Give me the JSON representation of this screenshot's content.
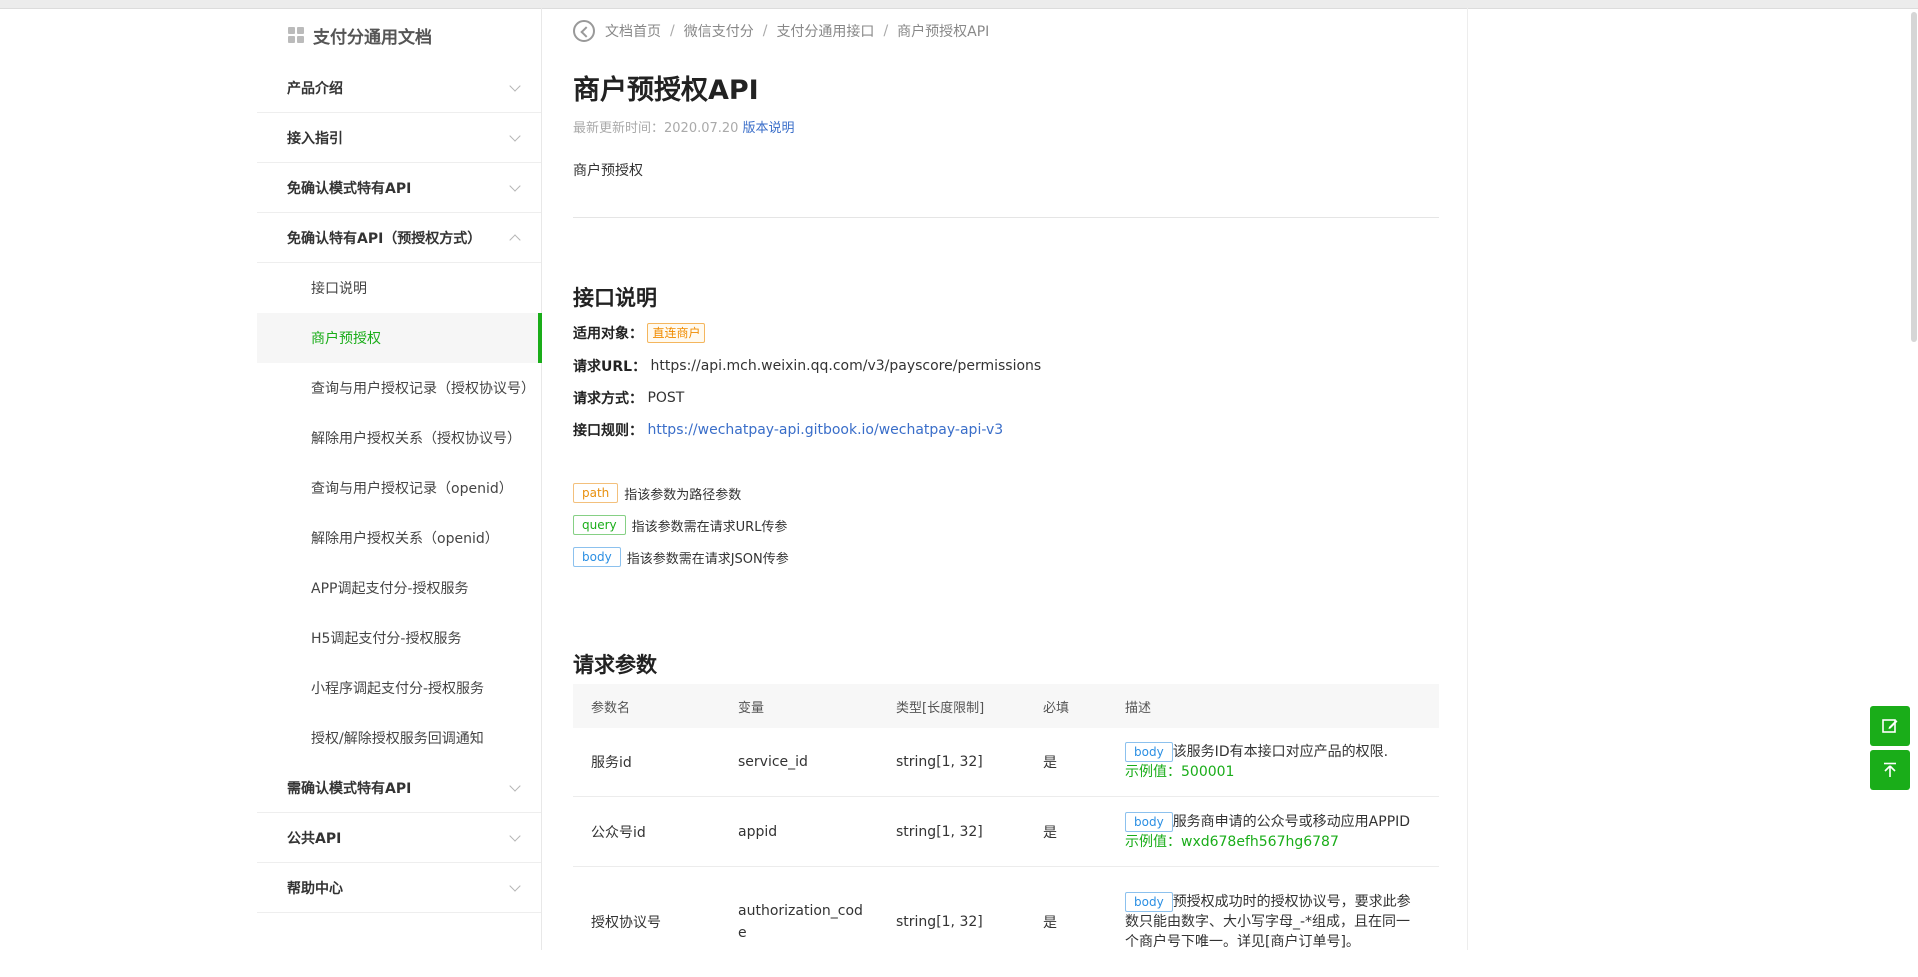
{
  "sidebar": {
    "title": "支付分通用文档",
    "sections": [
      {
        "label": "产品介绍"
      },
      {
        "label": "接入指引"
      },
      {
        "label": "免确认模式特有API"
      },
      {
        "label": "免确认特有API（预授权方式）"
      }
    ],
    "subitems": [
      {
        "label": "接口说明"
      },
      {
        "label": "商户预授权"
      },
      {
        "label": "查询与用户授权记录（授权协议号）"
      },
      {
        "label": "解除用户授权关系（授权协议号）"
      },
      {
        "label": "查询与用户授权记录（openid）"
      },
      {
        "label": "解除用户授权关系（openid）"
      },
      {
        "label": "APP调起支付分-授权服务"
      },
      {
        "label": "H5调起支付分-授权服务"
      },
      {
        "label": "小程序调起支付分-授权服务"
      },
      {
        "label": "授权/解除授权服务回调通知"
      }
    ],
    "sections_after": [
      {
        "label": "需确认模式特有API"
      },
      {
        "label": "公共API"
      },
      {
        "label": "帮助中心"
      }
    ]
  },
  "breadcrumb": [
    "文档首页",
    "微信支付分",
    "支付分通用接口",
    "商户预授权API"
  ],
  "page": {
    "title": "商户预授权API",
    "updated_label": "最新更新时间：2020.07.20",
    "version_link": "版本说明",
    "description": "商户预授权"
  },
  "api": {
    "heading": "接口说明",
    "target_label": "适用对象：",
    "target_value": "直连商户",
    "url_label": "请求URL：",
    "url_value": "https://api.mch.weixin.qq.com/v3/payscore/permissions",
    "method_label": "请求方式：",
    "method_value": "POST",
    "rule_label": "接口规则：",
    "rule_value": "https://wechatpay-api.gitbook.io/wechatpay-api-v3"
  },
  "legend": [
    {
      "chip": "path",
      "text": "指该参数为路径参数"
    },
    {
      "chip": "query",
      "text": "指该参数需在请求URL传参"
    },
    {
      "chip": "body",
      "text": "指该参数需在请求JSON传参"
    }
  ],
  "params": {
    "heading": "请求参数",
    "columns": [
      "参数名",
      "变量",
      "类型[长度限制]",
      "必填",
      "描述"
    ],
    "rows": [
      {
        "name": "服务id",
        "var": "service_id",
        "type": "string[1, 32]",
        "required": "是",
        "chip": "body",
        "desc": "该服务ID有本接口对应产品的权限.",
        "example": "示例值：500001"
      },
      {
        "name": "公众号id",
        "var": "appid",
        "type": "string[1, 32]",
        "required": "是",
        "chip": "body",
        "desc": "服务商申请的公众号或移动应用APPID",
        "example": "示例值：wxd678efh567hg6787"
      },
      {
        "name": "授权协议号",
        "var": "authorization_code",
        "type": "string[1, 32]",
        "required": "是",
        "chip": "body",
        "desc": "预授权成功时的授权协议号，要求此参数只能由数字、大小写字母_-*组成，且在同一个商户号下唯一。详见[商户订单号]。",
        "example": ""
      }
    ]
  },
  "fab": [
    {
      "icon": "edit-icon"
    },
    {
      "icon": "arrow-up-icon"
    }
  ]
}
